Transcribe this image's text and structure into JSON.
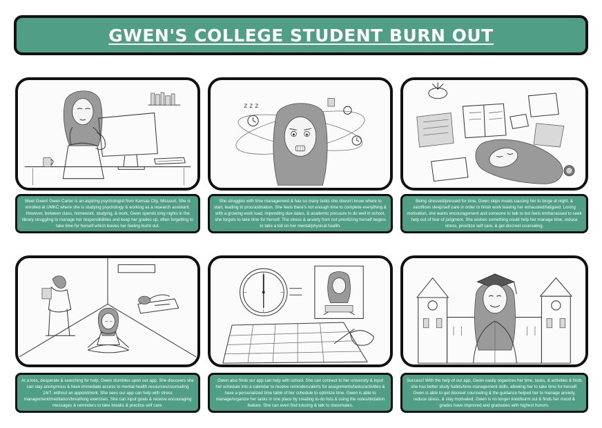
{
  "title": "GWEN'S COLLEGE STUDENT BURN OUT",
  "panels": [
    {
      "caption": "Meet Gwen! Gwen Carter is an aspiring psychologist from Kansas City, Missouri. She is enrolled at UMKC where she is studying psychology & working as a research assistant. However, between class, homework, studying, & work, Gwen spends long nights in the library struggling to manage her responsibilities and keep her grades up, often forgetting to take time for herself which leaves her feeling burnt out."
    },
    {
      "caption": "She struggles with time management & has so many tasks she doesn't know where to start, leading to procrastination. She feels there's not enough time to complete everything & with a growing work load, impending due dates, & academic pressure to do well in school, she forgets to take time for herself. The stress & anxiety from not prioritizing herself begins to take a toll on her mental/physical health."
    },
    {
      "caption": "Being stressed/pressed for time, Gwen skips meals causing her to binge at night, & sacrifices sleep/self care in order to finish work leaving her exhausted/fatigued. Losing motivation, she wants encouragement and someone to talk to but feels embarrassed to seek help out of fear of judgment. She wishes something could help her manage time, reduce stress, prioritize self care, & get discreet counseling."
    },
    {
      "caption": "At a loss, desperate & searching for help, Gwen stumbles upon our app. She discovers she can stay anonymous & have immediate access to mental health resources/counseling 24/7, without an appointment. She sees our app can help with stress management/meditation/breathing exercises. She can input goals & receive encouraging messages & reminders to take breaks & practice self care."
    },
    {
      "caption": "Gwen also finds our app can help with school. She can connect to her university & input her schedule into a calendar to receive reminders/alerts for assignments/tasks/activities & have a personalized time table of her schedule to optimize time. Gwen is able to manage/organize her tasks in one place by creating to-do lists & using the notes/dictation feature. She can even find tutoring & talk to classmates."
    },
    {
      "caption": "Success! With the help of our app, Gwen easily organizes her time, tasks, & activities & finds she has better study habits/time management skills, allowing her to take time for herself. Gwen is able to get discreet counseling & the guidance helped her to manage anxiety, reduce stress, & stay motivated. Gwen is no longer tired/burnt out & finds her mood & grades have improved and graduates with highest honors."
    }
  ],
  "sketch_text": {
    "snore": "z z z"
  },
  "colors": {
    "accent": "#4f9e85",
    "border": "#111111"
  }
}
